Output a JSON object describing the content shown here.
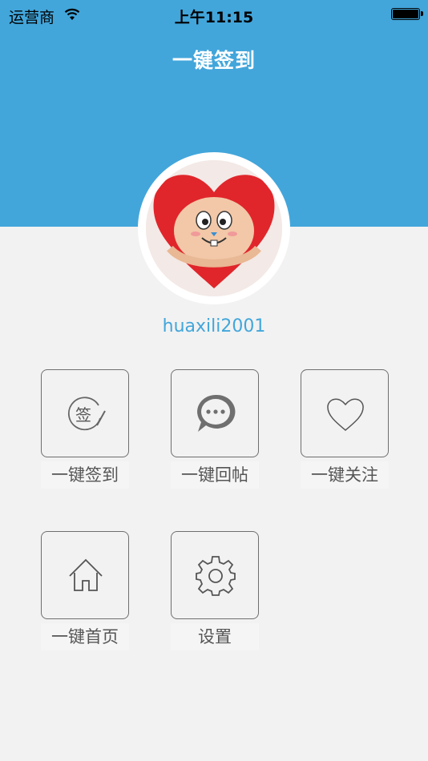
{
  "status": {
    "carrier": "运营商",
    "time": "上午11:15"
  },
  "header": {
    "title": "一键签到"
  },
  "profile": {
    "username": "huaxili2001"
  },
  "tiles": [
    {
      "label": "一键签到",
      "icon": "signin-icon"
    },
    {
      "label": "一键回帖",
      "icon": "chat-bubble-icon"
    },
    {
      "label": "一键关注",
      "icon": "heart-icon"
    },
    {
      "label": "一键首页",
      "icon": "home-icon"
    },
    {
      "label": "设置",
      "icon": "gear-icon"
    }
  ],
  "icon_glyphs": {
    "signin": "签"
  },
  "colors": {
    "header": "#42a6db",
    "accent": "#42a6db",
    "background": "#f2f2f2"
  }
}
